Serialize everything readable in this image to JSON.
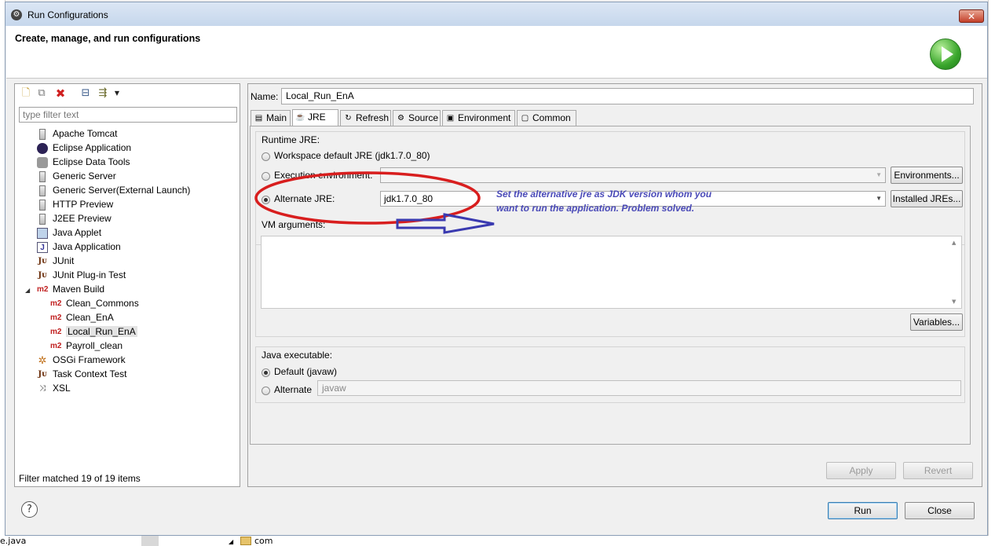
{
  "window": {
    "title": "Run Configurations",
    "header_title": "Create, manage, and run configurations"
  },
  "background": {
    "bottom_left_text": "e.java",
    "bottom_tree_text": "com"
  },
  "left_panel": {
    "filter_placeholder": "type filter text",
    "tree": [
      {
        "label": "Apache Tomcat",
        "icon": "generic-launch-icon"
      },
      {
        "label": "Eclipse Application",
        "icon": "eclipse-icon"
      },
      {
        "label": "Eclipse Data Tools",
        "icon": "database-icon"
      },
      {
        "label": "Generic Server",
        "icon": "generic-launch-icon"
      },
      {
        "label": "Generic Server(External Launch)",
        "icon": "generic-launch-icon"
      },
      {
        "label": "HTTP Preview",
        "icon": "generic-launch-icon"
      },
      {
        "label": "J2EE Preview",
        "icon": "generic-launch-icon"
      },
      {
        "label": "Java Applet",
        "icon": "applet-icon"
      },
      {
        "label": "Java Application",
        "icon": "java-app-icon"
      },
      {
        "label": "JUnit",
        "icon": "junit-icon"
      },
      {
        "label": "JUnit Plug-in Test",
        "icon": "junit-plugin-icon"
      },
      {
        "label": "Maven Build",
        "icon": "m2-icon"
      },
      {
        "label": "Clean_Commons",
        "icon": "m2-icon"
      },
      {
        "label": "Clean_EnA",
        "icon": "m2-icon"
      },
      {
        "label": "Local_Run_EnA",
        "icon": "m2-icon",
        "selected": true
      },
      {
        "label": "Payroll_clean",
        "icon": "m2-icon"
      },
      {
        "label": "OSGi Framework",
        "icon": "osgi-icon"
      },
      {
        "label": "Task Context Test",
        "icon": "junit-icon"
      },
      {
        "label": "XSL",
        "icon": "xsl-icon"
      }
    ],
    "filter_status": "Filter matched 19 of 19 items"
  },
  "config": {
    "name_label": "Name:",
    "name_value": "Local_Run_EnA",
    "tabs": [
      {
        "label": "Main",
        "icon": "main-tab-icon"
      },
      {
        "label": "JRE",
        "icon": "jre-tab-icon",
        "active": true
      },
      {
        "label": "Refresh",
        "icon": "refresh-tab-icon"
      },
      {
        "label": "Source",
        "icon": "source-tab-icon"
      },
      {
        "label": "Environment",
        "icon": "environment-tab-icon"
      },
      {
        "label": "Common",
        "icon": "common-tab-icon"
      }
    ],
    "runtime_jre_label": "Runtime JRE:",
    "workspace_default_label": "Workspace default JRE (jdk1.7.0_80)",
    "execution_env_label": "Execution environment:",
    "execution_env_value": "",
    "environments_button": "Environments...",
    "alternate_jre_label": "Alternate JRE:",
    "alternate_jre_value": "jdk1.7.0_80",
    "installed_jres_button": "Installed JREs...",
    "selected_jre_option": "alternate",
    "vm_arguments_label": "VM arguments:",
    "vm_arguments_value": "",
    "variables_button": "Variables...",
    "java_executable_label": "Java executable:",
    "default_javaw_label": "Default (javaw)",
    "alternate_label": "Alternate",
    "alternate_exec_value": "javaw",
    "apply_button": "Apply",
    "revert_button": "Revert"
  },
  "annotation": {
    "text": "Set the alternative jre   as JDK version whom you want to run the application.  Problem solved.",
    "color": "#4a4ab8",
    "ellipse_color": "#d81e1e"
  },
  "footer": {
    "run_button": "Run",
    "close_button": "Close"
  }
}
